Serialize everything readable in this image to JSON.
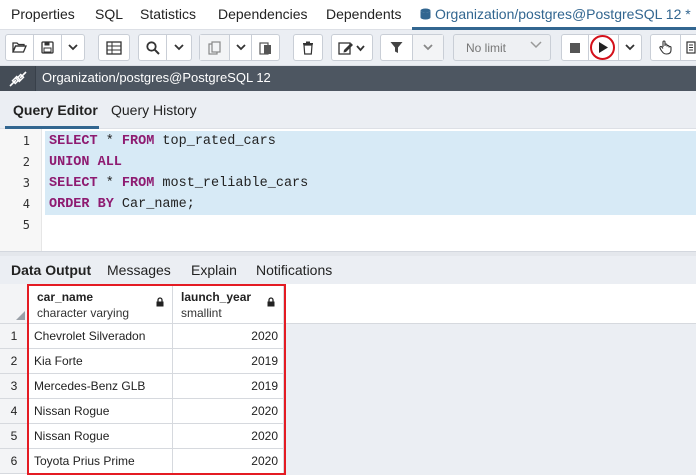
{
  "top_tabs": {
    "items": [
      "Properties",
      "SQL",
      "Statistics",
      "Dependencies",
      "Dependents"
    ],
    "active_tab": "Organization/postgres@PostgreSQL 12 *"
  },
  "toolbar": {
    "limit_value": "No limit",
    "icons": [
      "open-file",
      "save",
      "save-dropdown",
      "save-data-changes",
      "find",
      "find-dropdown",
      "copy",
      "copy-dropdown",
      "paste-row",
      "delete-row",
      "edit",
      "edit-dropdown",
      "filter",
      "filter-dropdown",
      "cancel-query",
      "execute",
      "execute-dropdown",
      "lock-row",
      "macros"
    ],
    "highlight_color": "#d4101a"
  },
  "connection_bar": {
    "title": "Organization/postgres@PostgreSQL 12"
  },
  "editor_tabs": {
    "items": [
      "Query Editor",
      "Query History"
    ],
    "active": "Query Editor"
  },
  "editor": {
    "lines": [
      {
        "number": "1",
        "tokens": [
          {
            "t": "SELECT",
            "kw": true
          },
          {
            "t": " * ",
            "kw": false
          },
          {
            "t": "FROM",
            "kw": true
          },
          {
            "t": " top_rated_cars",
            "kw": false
          }
        ]
      },
      {
        "number": "2",
        "tokens": [
          {
            "t": "UNION ALL",
            "kw": true
          }
        ]
      },
      {
        "number": "3",
        "tokens": [
          {
            "t": "SELECT",
            "kw": true
          },
          {
            "t": " * ",
            "kw": false
          },
          {
            "t": "FROM",
            "kw": true
          },
          {
            "t": " most_reliable_cars",
            "kw": false
          }
        ]
      },
      {
        "number": "4",
        "tokens": [
          {
            "t": "ORDER BY",
            "kw": true
          },
          {
            "t": " Car_name;",
            "kw": false
          }
        ]
      },
      {
        "number": "5",
        "tokens": []
      }
    ],
    "keyword_color": "#8e1b71",
    "selection_color": "#d7eaf6"
  },
  "output_tabs": {
    "items": [
      "Data Output",
      "Messages",
      "Explain",
      "Notifications"
    ],
    "active": "Data Output"
  },
  "result": {
    "columns": [
      {
        "name": "car_name",
        "type": "character varying"
      },
      {
        "name": "launch_year",
        "type": "smallint"
      }
    ],
    "rows": [
      {
        "n": "1",
        "car_name": "Chevrolet Silveradon",
        "launch_year": "2020"
      },
      {
        "n": "2",
        "car_name": "Kia Forte",
        "launch_year": "2019"
      },
      {
        "n": "3",
        "car_name": "Mercedes-Benz GLB",
        "launch_year": "2019"
      },
      {
        "n": "4",
        "car_name": "Nissan Rogue",
        "launch_year": "2020"
      },
      {
        "n": "5",
        "car_name": "Nissan Rogue",
        "launch_year": "2020"
      },
      {
        "n": "6",
        "car_name": "Toyota Prius Prime",
        "launch_year": "2020"
      }
    ],
    "highlight_color": "#e41b23"
  }
}
